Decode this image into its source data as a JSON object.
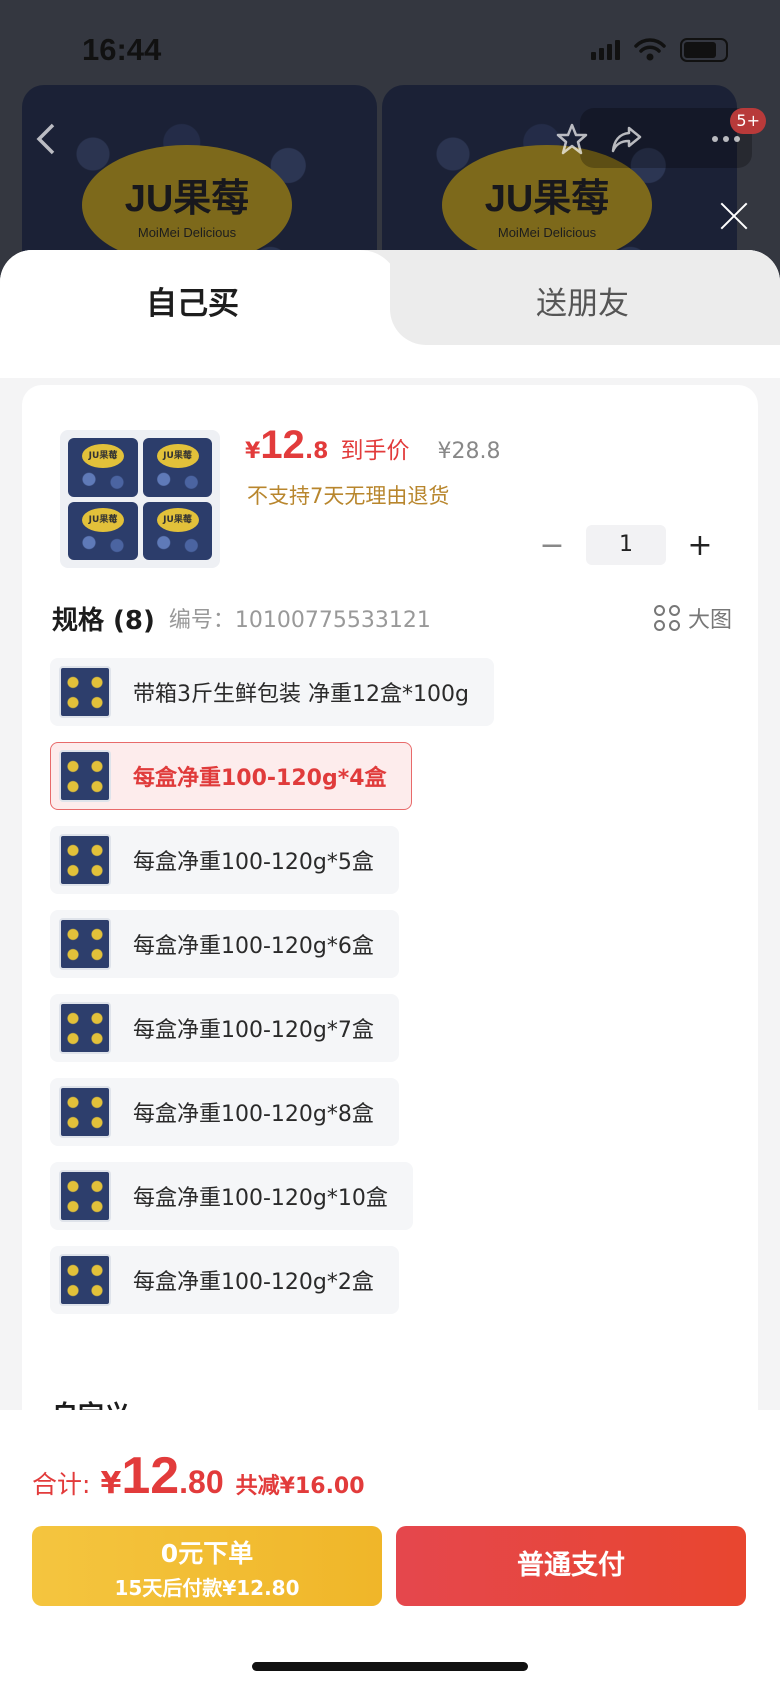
{
  "status_bar": {
    "time": "16:44"
  },
  "background": {
    "brand_label": "JU果莓",
    "brand_sub": "MoiMei Delicious",
    "cart_badge": "5+",
    "icons": [
      "back-arrow-icon",
      "star-icon",
      "share-icon",
      "more-icon",
      "close-icon"
    ]
  },
  "tabs": [
    {
      "label": "自己买",
      "active": true
    },
    {
      "label": "送朋友",
      "active": false
    }
  ],
  "product": {
    "currency": "¥",
    "price_int": "12",
    "price_dec": ".8",
    "price_label": "到手价",
    "original_price": "¥28.8",
    "return_policy": "不支持7天无理由退货",
    "quantity": "1",
    "minus_symbol": "−",
    "plus_symbol": "+"
  },
  "spec": {
    "title": "规格 (8)",
    "sku_label": "编号：10100775533121",
    "big_image_label": "大图",
    "options": [
      {
        "label": "带箱3斤生鲜包装 净重12盒*100g",
        "selected": false
      },
      {
        "label": "每盒净重100-120g*4盒",
        "selected": true
      },
      {
        "label": "每盒净重100-120g*5盒",
        "selected": false
      },
      {
        "label": "每盒净重100-120g*6盒",
        "selected": false
      },
      {
        "label": "每盒净重100-120g*7盒",
        "selected": false
      },
      {
        "label": "每盒净重100-120g*8盒",
        "selected": false
      },
      {
        "label": "每盒净重100-120g*10盒",
        "selected": false
      },
      {
        "label": "每盒净重100-120g*2盒",
        "selected": false
      }
    ]
  },
  "custom": {
    "title": "自定义"
  },
  "footer": {
    "total_label": "合计:",
    "currency": "¥",
    "total_int": "12",
    "total_dec": ".80",
    "saving": "共减¥16.00",
    "later_line1": "0元下单",
    "later_line2": "15天后付款¥12.80",
    "pay_label": "普通支付"
  },
  "colors": {
    "accent_red": "#e23b3b",
    "gold": "#f2bf36",
    "return_text": "#b8862d"
  }
}
